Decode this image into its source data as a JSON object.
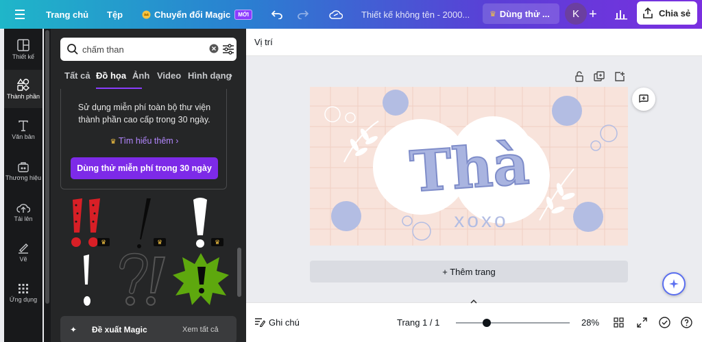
{
  "topbar": {
    "home": "Trang chủ",
    "file": "Tệp",
    "magic": "Chuyển đổi Magic",
    "magic_badge": "MỚI",
    "title": "Thiết kế không tên - 2000...",
    "trial": "Dùng thử ...",
    "avatar_initial": "K",
    "share": "Chia sẻ"
  },
  "rail": [
    {
      "label": "Thiết kế",
      "icon": "layout-icon"
    },
    {
      "label": "Thành phần",
      "icon": "shapes-icon"
    },
    {
      "label": "Văn bản",
      "icon": "text-icon"
    },
    {
      "label": "Thương hiệu",
      "icon": "brand-icon"
    },
    {
      "label": "Tải lên",
      "icon": "upload-icon"
    },
    {
      "label": "Vẽ",
      "icon": "draw-icon"
    },
    {
      "label": "Ứng dụng",
      "icon": "apps-icon"
    }
  ],
  "search": {
    "value": "chấm than"
  },
  "tabs": [
    "Tất cả",
    "Đồ họa",
    "Ảnh",
    "Video",
    "Hình dạng"
  ],
  "promo": {
    "text": "Sử dụng miễn phí toàn bộ thư viện thành phần cao cấp trong 30 ngày.",
    "link": "Tìm hiểu thêm",
    "button": "Dùng thử miễn phí trong 30 ngày"
  },
  "magic_row": {
    "label": "Đề xuất Magic",
    "see_all": "Xem tất cả"
  },
  "subbar": {
    "position": "Vị trí"
  },
  "design": {
    "main_text": "Thà",
    "sub_text": "xoxo"
  },
  "add_page": "+ Thêm trang",
  "footer": {
    "notes": "Ghi chú",
    "page": "Trang 1 / 1",
    "zoom": "28%",
    "zoom_level": 0.28
  },
  "colors": {
    "accent": "#8b3dff",
    "panel": "#252627",
    "rail": "#18191b"
  }
}
